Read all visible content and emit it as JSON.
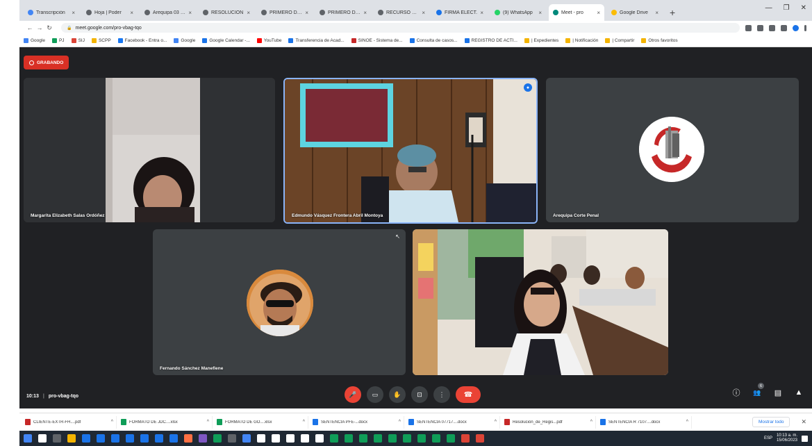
{
  "browser": {
    "tabs": [
      {
        "label": "Transcripción",
        "color": "#4285f4"
      },
      {
        "label": "Hoja | Poder",
        "color": "#5f6368"
      },
      {
        "label": "Arequipa 03 - ...",
        "color": "#5f6368"
      },
      {
        "label": "RESOLUCION",
        "color": "#5f6368"
      },
      {
        "label": "PRIMERO DE...",
        "color": "#5f6368"
      },
      {
        "label": "PRIMERO DE...",
        "color": "#5f6368"
      },
      {
        "label": "RECURSO DE...",
        "color": "#5f6368"
      },
      {
        "label": "FIRMA ELECT.",
        "color": "#1a73e8"
      },
      {
        "label": "(9) WhatsApp",
        "color": "#25d366"
      },
      {
        "label": "Meet - pro",
        "color": "#00897b",
        "active": true
      },
      {
        "label": "Google Drive",
        "color": "#fbbc04"
      }
    ],
    "new_tab": "+",
    "window_controls": [
      "—",
      "❐",
      "✕"
    ],
    "url": "meet.google.com/pro-vbag-tqo",
    "bookmarks": [
      {
        "label": "Google",
        "color": "#4285f4"
      },
      {
        "label": "PJ",
        "color": "#0f9d58"
      },
      {
        "label": "SIJ",
        "color": "#db4437"
      },
      {
        "label": "SCPP",
        "color": "#f4b400"
      },
      {
        "label": "Facebook - Entra o...",
        "color": "#1877f2"
      },
      {
        "label": "Google",
        "color": "#4285f4"
      },
      {
        "label": "Google Calendar -...",
        "color": "#1a73e8"
      },
      {
        "label": "YouTube",
        "color": "#ff0000"
      },
      {
        "label": "Transferencia de Acad...",
        "color": "#1a73e8"
      },
      {
        "label": "SINOE - Sistema de...",
        "color": "#c62828"
      },
      {
        "label": "Consulta de casos...",
        "color": "#1a73e8"
      },
      {
        "label": "REGISTRO DE ACTI...",
        "color": "#1a73e8"
      },
      {
        "label": "| Expedientes",
        "color": "#f4b400"
      },
      {
        "label": "| Notificación",
        "color": "#f4b400"
      },
      {
        "label": "| Compartir",
        "color": "#f4b400"
      },
      {
        "label": "Otros favoritos",
        "color": "#f4b400"
      }
    ]
  },
  "meet": {
    "recording_label": "GRABANDO",
    "participants": [
      {
        "name": "Margarita Elizabeth Salas Ordóñez"
      },
      {
        "name": "Edmundo Vásquez Frontera Abril Montoya"
      },
      {
        "name": "Arequipa Corte Penal"
      },
      {
        "name": "Fernando Sánchez Manefiene"
      },
      {
        "name": ""
      }
    ],
    "time": "10:13",
    "meeting_code": "pro-vbag-tqo",
    "participant_count": "6",
    "colors": {
      "background": "#202124",
      "tile": "#3c4043",
      "hangup": "#ea4335",
      "speaking": "#8ab4f8"
    }
  },
  "controls": {
    "mic": "mic-off-icon",
    "camera": "camera-icon",
    "hand": "hand-icon",
    "present": "present-icon",
    "more": "more-icon",
    "hangup": "hangup-icon",
    "info": "ⓘ",
    "people": "👥",
    "chat": "▤",
    "activities": "▲"
  },
  "downloads": {
    "items": [
      {
        "label": "CLIENTE-EXTR-FH....pdf",
        "color": "#c62828"
      },
      {
        "label": "FORMATO DE JDC....xlsx",
        "color": "#0f9d58"
      },
      {
        "label": "FORMATO DE GO....xlsx",
        "color": "#0f9d58"
      },
      {
        "label": "SENTENCIA PFE-...docx",
        "color": "#1a73e8"
      },
      {
        "label": "SENTENCIA 07717....docx",
        "color": "#1a73e8"
      },
      {
        "label": "Resolución_de_Regis...pdf",
        "color": "#c62828"
      },
      {
        "label": "SENTENCIA R 7107....docx",
        "color": "#1a73e8"
      }
    ],
    "show_all": "Mostrar todo",
    "close": "✕"
  },
  "taskbar": {
    "icons": [
      "#4285f4",
      "#ffffff",
      "#5f6368",
      "#f4b400",
      "#1a73e8",
      "#1a73e8",
      "#1a73e8",
      "#1a73e8",
      "#1a73e8",
      "#1a73e8",
      "#1a73e8",
      "#ff7043",
      "#7e57c2",
      "#0f9d58",
      "#5f6368",
      "#4285f4",
      "#ffffff",
      "#ffffff",
      "#ffffff",
      "#ffffff",
      "#ffffff",
      "#0f9d58",
      "#0f9d58",
      "#0f9d58",
      "#0f9d58",
      "#0f9d58",
      "#0f9d58",
      "#0f9d58",
      "#0f9d58",
      "#0f9d58",
      "#db4437",
      "#db4437"
    ],
    "clock": "10:13 a. m.",
    "date": "15/06/2023",
    "tray": "ESP"
  }
}
